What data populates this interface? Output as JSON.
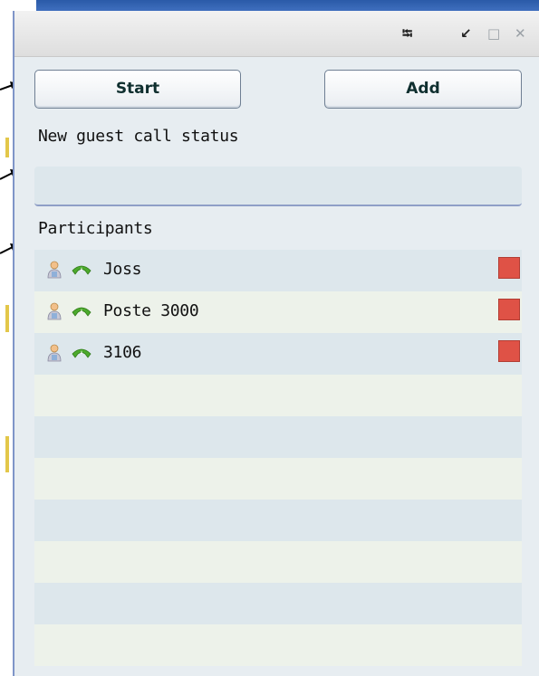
{
  "window": {
    "controls": [
      "pin-icon",
      "restore-icon",
      "maximize-icon",
      "close-icon"
    ]
  },
  "toolbar": {
    "start_label": "Start",
    "add_label": "Add"
  },
  "status": {
    "label": "New guest call status",
    "value": ""
  },
  "participants": {
    "label": "Participants",
    "items": [
      {
        "name": "Joss",
        "icons": [
          "person-icon",
          "phone-icon"
        ],
        "action": "remove-icon"
      },
      {
        "name": "Poste 3000",
        "icons": [
          "person-icon",
          "phone-icon"
        ],
        "action": "remove-icon"
      },
      {
        "name": "3106",
        "icons": [
          "person-icon",
          "phone-icon"
        ],
        "action": "remove-icon"
      }
    ],
    "empty_rows": 7
  },
  "colors": {
    "row_blue": "#dde7ec",
    "row_green": "#edf2ea",
    "remove_red": "#df5246",
    "phone_green": "#4caa2c"
  }
}
